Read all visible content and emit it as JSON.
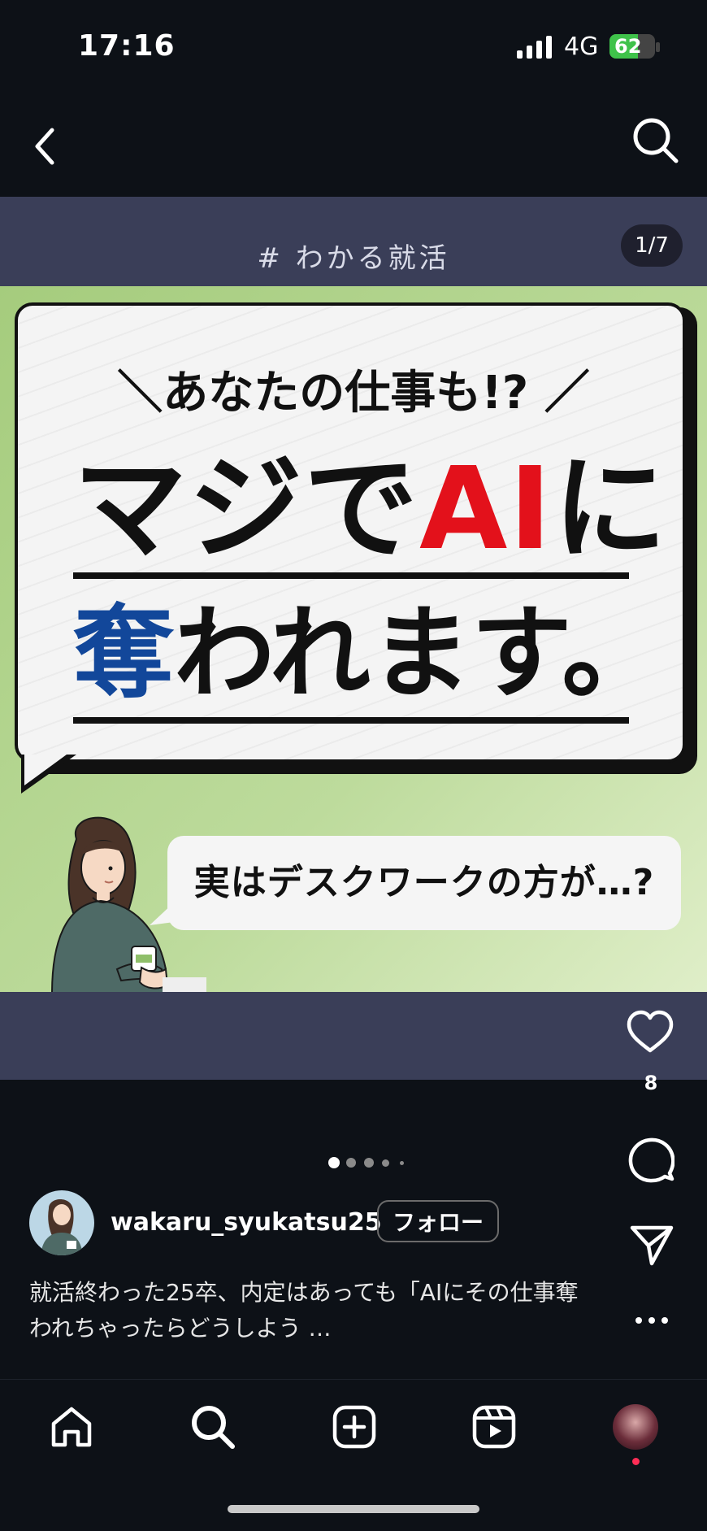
{
  "status_bar": {
    "time": "17:16",
    "network": "4G",
    "battery": "62",
    "battery_level": 0.62
  },
  "post": {
    "hashtag": "# わかる就活",
    "page_counter": "1/7",
    "slide": {
      "line1": "＼あなたの仕事も!? ／",
      "line2_pre": "マジで",
      "line2_ai": "AI",
      "line2_post": "に",
      "line3_blue": "奪",
      "line3_rest": "われます。",
      "sub_text": "実はデスクワークの方が…?"
    },
    "carousel_dots": 5,
    "carousel_active": 0
  },
  "actions": {
    "like_count": "8"
  },
  "author": {
    "username": "wakaru_syukatsu25",
    "follow_label": "フォロー"
  },
  "caption": {
    "text": "就活終わった25卒、内定はあっても「AIにその仕事奪われちゃったらどうしよう …"
  },
  "icons": {
    "back": "chevron-left-icon",
    "search": "search-icon",
    "like": "heart-icon",
    "comment": "comment-icon",
    "share": "send-icon",
    "more": "more-icon",
    "home": "home-icon",
    "explore": "search-icon",
    "create": "plus-square-icon",
    "reels": "reels-icon"
  }
}
